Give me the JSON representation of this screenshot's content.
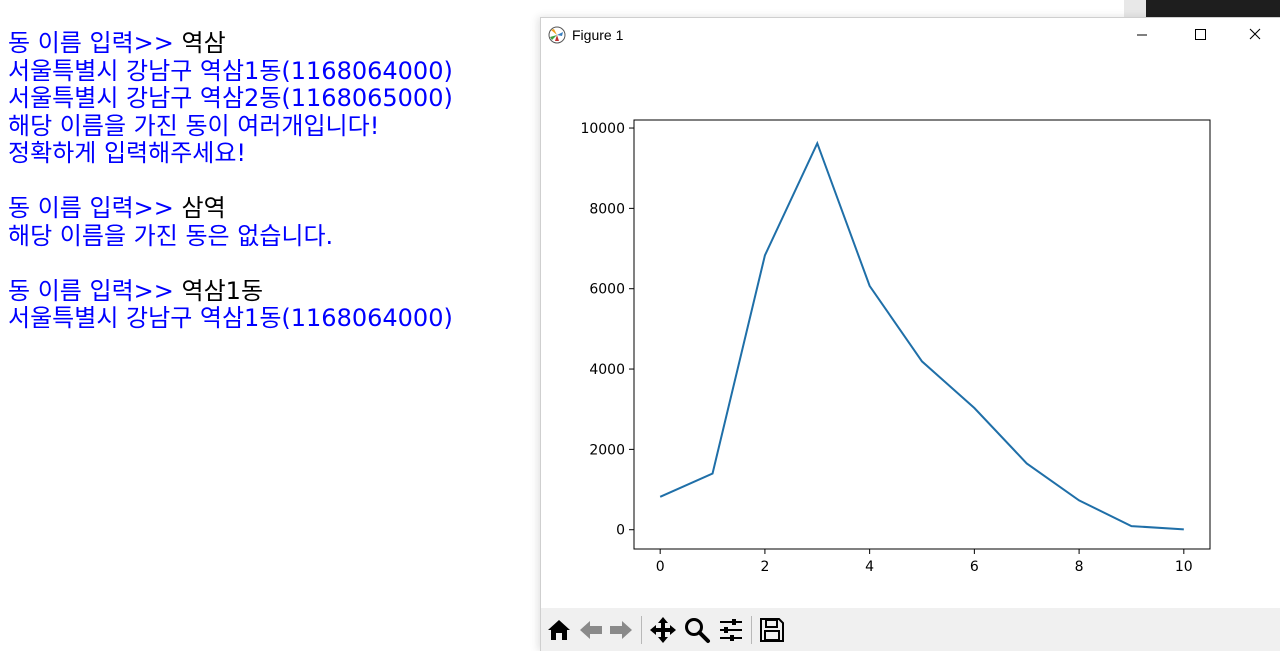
{
  "console": {
    "lines": [
      {
        "segments": [
          {
            "text": "동 이름 입력>> ",
            "color": "blue"
          },
          {
            "text": "역삼",
            "color": "black"
          }
        ]
      },
      {
        "segments": [
          {
            "text": "서울특별시 강남구 역삼1동(1168064000)",
            "color": "blue"
          }
        ]
      },
      {
        "segments": [
          {
            "text": "서울특별시 강남구 역삼2동(1168065000)",
            "color": "blue"
          }
        ]
      },
      {
        "segments": [
          {
            "text": "해당 이름을 가진 동이 여러개입니다!",
            "color": "blue"
          }
        ]
      },
      {
        "segments": [
          {
            "text": "정확하게 입력해주세요!",
            "color": "blue"
          }
        ]
      },
      {
        "segments": []
      },
      {
        "segments": [
          {
            "text": "동 이름 입력>> ",
            "color": "blue"
          },
          {
            "text": "삼역",
            "color": "black"
          }
        ]
      },
      {
        "segments": [
          {
            "text": "해당 이름을 가진 동은 없습니다.",
            "color": "blue"
          }
        ]
      },
      {
        "segments": []
      },
      {
        "segments": [
          {
            "text": "동 이름 입력>> ",
            "color": "blue"
          },
          {
            "text": "역삼1동",
            "color": "black"
          }
        ]
      },
      {
        "segments": [
          {
            "text": "서울특별시 강남구 역삼1동(1168064000)",
            "color": "blue"
          }
        ]
      }
    ]
  },
  "window": {
    "title": "Figure 1",
    "controls": [
      "minimize-icon",
      "maximize-icon",
      "close-icon"
    ]
  },
  "toolbar": {
    "icons": [
      "home-icon",
      "back-arrow-icon",
      "forward-arrow-icon",
      "pan-icon",
      "zoom-icon",
      "configure-subplots-icon",
      "save-icon"
    ]
  },
  "colors": {
    "console_text": "#0000ff",
    "input_text": "#000000",
    "line": "#1f6fa8"
  },
  "chart_data": {
    "type": "line",
    "x": [
      0,
      1,
      2,
      3,
      4,
      5,
      6,
      7,
      8,
      9,
      10
    ],
    "series": [
      {
        "values": [
          820,
          1400,
          6830,
          9620,
          6070,
          4190,
          3030,
          1650,
          730,
          90,
          10
        ]
      }
    ],
    "xticks": [
      0,
      2,
      4,
      6,
      8,
      10
    ],
    "yticks": [
      0,
      2000,
      4000,
      6000,
      8000,
      10000
    ],
    "xlim": [
      -0.5,
      10.5
    ],
    "ylim": [
      -480,
      10200
    ],
    "grid": false,
    "title": "",
    "xlabel": "",
    "ylabel": ""
  }
}
